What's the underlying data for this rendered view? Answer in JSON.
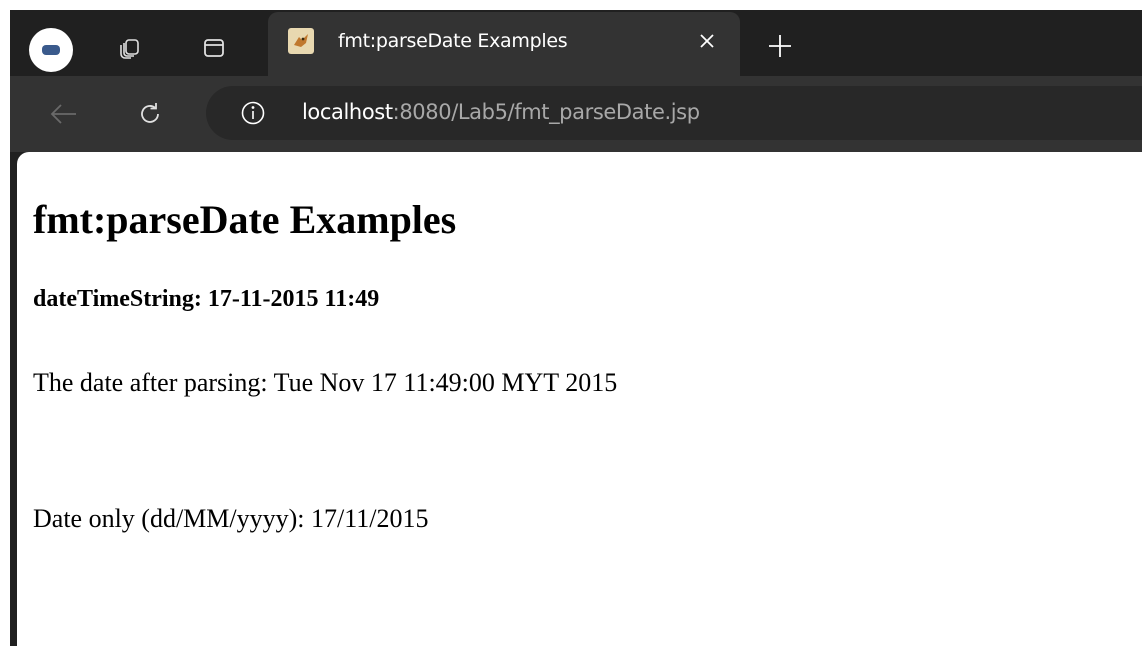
{
  "browser": {
    "tab": {
      "title": "fmt:parseDate Examples",
      "close_icon": "close-icon"
    },
    "icons": {
      "profile": "profile-avatar-icon",
      "workspaces": "workspaces-icon",
      "tab_actions": "tab-actions-icon",
      "new_tab": "plus-icon",
      "back": "back-arrow-icon",
      "reload": "reload-icon",
      "site_info": "info-icon"
    },
    "address": {
      "host": "localhost",
      "rest": ":8080/Lab5/fmt_parseDate.jsp"
    }
  },
  "page": {
    "heading": "fmt:parseDate Examples",
    "subheading": "dateTimeString: 17-11-2015 11:49",
    "parsed_line": "The date after parsing: Tue Nov 17 11:49:00 MYT 2015",
    "date_only_line": "Date only (dd/MM/yyyy): 17/11/2015"
  },
  "colors": {
    "chrome_dark": "#202020",
    "toolbar": "#333333",
    "omnibox": "#282828",
    "page_bg": "#ffffff"
  }
}
